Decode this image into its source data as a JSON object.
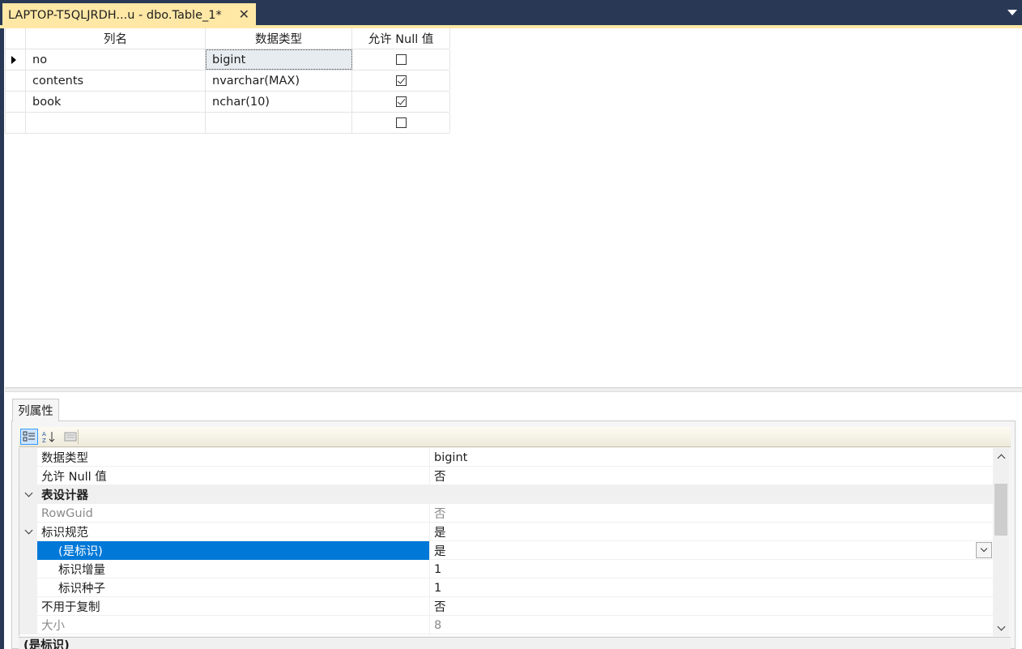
{
  "tab": {
    "title": "LAPTOP-T5QLJRDH...u - dbo.Table_1*",
    "close": "✕"
  },
  "designer": {
    "headers": [
      "列名",
      "数据类型",
      "允许 Null 值"
    ],
    "rows": [
      {
        "name": "no",
        "type": "bigint",
        "allow_null": false,
        "current": true
      },
      {
        "name": "contents",
        "type": "nvarchar(MAX)",
        "allow_null": true
      },
      {
        "name": "book",
        "type": "nchar(10)",
        "allow_null": true
      },
      {
        "name": "",
        "type": "",
        "allow_null": false
      }
    ]
  },
  "properties": {
    "tab_label": "列属性",
    "rows": [
      {
        "name": "数据类型",
        "value": "bigint"
      },
      {
        "name": "允许 Null 值",
        "value": "否"
      },
      {
        "name": "表设计器",
        "value": "",
        "category": true
      },
      {
        "name": "RowGuid",
        "value": "否",
        "disabled": true
      },
      {
        "name": "标识规范",
        "value": "是",
        "expandable": true
      },
      {
        "name": "(是标识)",
        "value": "是",
        "selected": true,
        "indent": true
      },
      {
        "name": "标识增量",
        "value": "1",
        "indent": true
      },
      {
        "name": "标识种子",
        "value": "1",
        "indent": true
      },
      {
        "name": "不用于复制",
        "value": "否"
      },
      {
        "name": "大小",
        "value": "8",
        "disabled": true
      }
    ],
    "description_title": "(是标识)"
  }
}
